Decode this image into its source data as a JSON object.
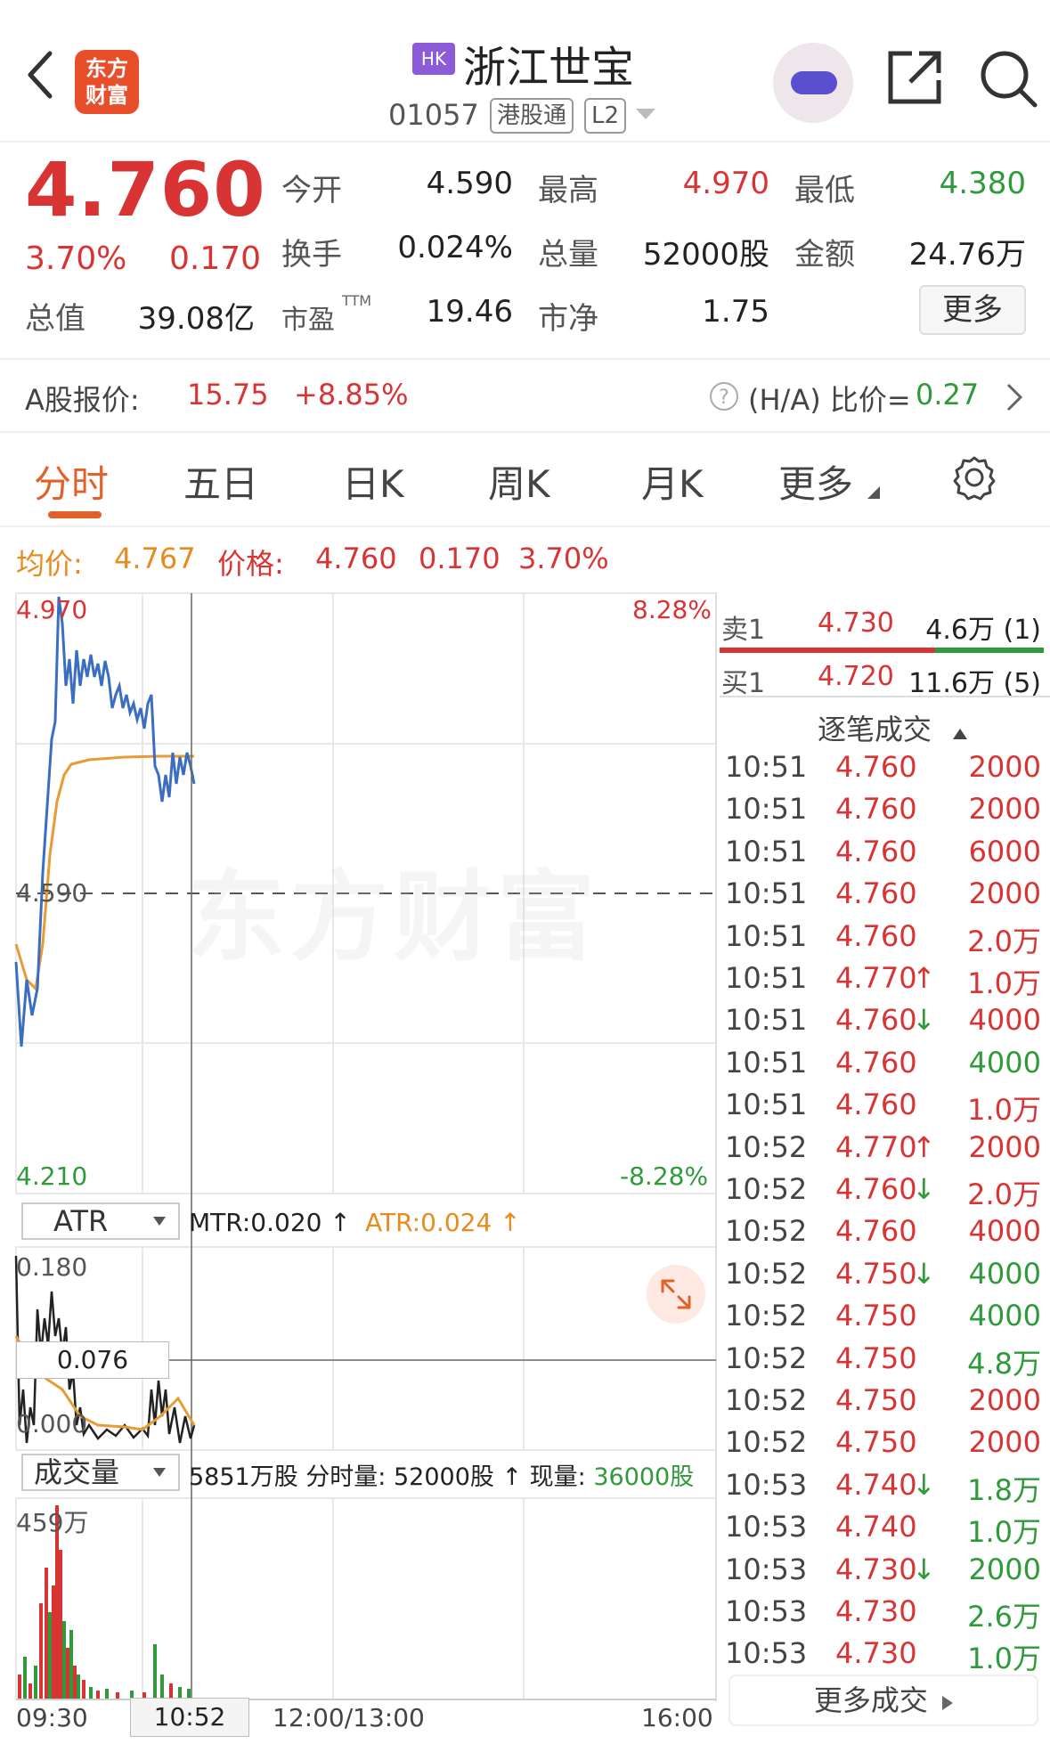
{
  "header": {
    "logo_text": "东方财富",
    "market_badge": "HK",
    "stock_name": "浙江世宝",
    "stock_code": "01057",
    "tags": [
      "港股通",
      "L2"
    ]
  },
  "quote": {
    "price": "4.760",
    "change_pct": "3.70%",
    "change": "0.170",
    "fields": [
      {
        "label": "今开",
        "value": "4.590",
        "color": "#222222"
      },
      {
        "label": "最高",
        "value": "4.970",
        "color": "#d93434"
      },
      {
        "label": "最低",
        "value": "4.380",
        "color": "#2f9a3a"
      },
      {
        "label": "换手",
        "value": "0.024%",
        "color": "#222222"
      },
      {
        "label": "总量",
        "value": "52000股",
        "color": "#222222"
      },
      {
        "label": "金额",
        "value": "24.76万",
        "color": "#222222"
      },
      {
        "label": "总值",
        "value": "39.08亿",
        "color": "#222222"
      },
      {
        "label": "市盈",
        "value": "19.46",
        "color": "#222222"
      },
      {
        "label": "市净",
        "value": "1.75",
        "color": "#222222"
      }
    ],
    "pe_superscript": "TTM",
    "more_button": "更多"
  },
  "a_share": {
    "label": "A股报价:",
    "price": "15.75",
    "change_pct": "+8.85%",
    "ha_label": "(H/A) 比价=",
    "ha_value": "0.27"
  },
  "tabs": [
    "分时",
    "五日",
    "日K",
    "周K",
    "月K",
    "更多"
  ],
  "intraday": {
    "avg_label": "均价:",
    "avg_value": "4.767",
    "price_label": "价格:",
    "price_value": "4.760",
    "change": "0.170",
    "change_pct": "3.70%",
    "y_max": "4.970",
    "y_open": "4.590",
    "y_min": "4.210",
    "pct_max": "8.28%",
    "pct_min": "-8.28%",
    "watermark": "东方财富"
  },
  "atr": {
    "dropdown": "ATR",
    "mtr_text": "MTR:0.020 ↑",
    "atr_text": "ATR:0.024 ↑",
    "y_max": "0.180",
    "y_cross": "0.076",
    "y_min": "0.000"
  },
  "volume": {
    "dropdown": "成交量",
    "summary_prefix": "5851万股",
    "summary_mid": " 分时量: 52000股 ↑ 现量: ",
    "current_volume": "36000股",
    "y_max": "459万",
    "time_labels": [
      "09:30",
      "10:52",
      "12:00/13:00",
      "16:00"
    ]
  },
  "orderbook": {
    "sell": {
      "label": "卖1",
      "price": "4.730",
      "volume": "4.6万 (1)"
    },
    "buy": {
      "label": "买1",
      "price": "4.720",
      "volume": "11.6万 (5)"
    }
  },
  "ticks_header": "逐笔成交",
  "ticks": [
    {
      "time": "10:51",
      "price": "4.760",
      "arrow": "",
      "vol": "2000",
      "vcolor": "#d93434"
    },
    {
      "time": "10:51",
      "price": "4.760",
      "arrow": "",
      "vol": "2000",
      "vcolor": "#d93434"
    },
    {
      "time": "10:51",
      "price": "4.760",
      "arrow": "",
      "vol": "6000",
      "vcolor": "#d93434"
    },
    {
      "time": "10:51",
      "price": "4.760",
      "arrow": "",
      "vol": "2000",
      "vcolor": "#d93434"
    },
    {
      "time": "10:51",
      "price": "4.760",
      "arrow": "",
      "vol": "2.0万",
      "vcolor": "#d93434"
    },
    {
      "time": "10:51",
      "price": "4.770",
      "arrow": "↑",
      "vol": "1.0万",
      "vcolor": "#d93434"
    },
    {
      "time": "10:51",
      "price": "4.760",
      "arrow": "↓",
      "vol": "4000",
      "vcolor": "#d93434"
    },
    {
      "time": "10:51",
      "price": "4.760",
      "arrow": "",
      "vol": "4000",
      "vcolor": "#2f9a3a"
    },
    {
      "time": "10:51",
      "price": "4.760",
      "arrow": "",
      "vol": "1.0万",
      "vcolor": "#d93434"
    },
    {
      "time": "10:52",
      "price": "4.770",
      "arrow": "↑",
      "vol": "2000",
      "vcolor": "#d93434"
    },
    {
      "time": "10:52",
      "price": "4.760",
      "arrow": "↓",
      "vol": "2.0万",
      "vcolor": "#d93434"
    },
    {
      "time": "10:52",
      "price": "4.760",
      "arrow": "",
      "vol": "4000",
      "vcolor": "#d93434"
    },
    {
      "time": "10:52",
      "price": "4.750",
      "arrow": "↓",
      "vol": "4000",
      "vcolor": "#2f9a3a"
    },
    {
      "time": "10:52",
      "price": "4.750",
      "arrow": "",
      "vol": "4000",
      "vcolor": "#2f9a3a"
    },
    {
      "time": "10:52",
      "price": "4.750",
      "arrow": "",
      "vol": "4.8万",
      "vcolor": "#2f9a3a"
    },
    {
      "time": "10:52",
      "price": "4.750",
      "arrow": "",
      "vol": "2000",
      "vcolor": "#d93434"
    },
    {
      "time": "10:52",
      "price": "4.750",
      "arrow": "",
      "vol": "2000",
      "vcolor": "#d93434"
    },
    {
      "time": "10:53",
      "price": "4.740",
      "arrow": "↓",
      "vol": "1.8万",
      "vcolor": "#2f9a3a"
    },
    {
      "time": "10:53",
      "price": "4.740",
      "arrow": "",
      "vol": "1.0万",
      "vcolor": "#2f9a3a"
    },
    {
      "time": "10:53",
      "price": "4.730",
      "arrow": "↓",
      "vol": "2000",
      "vcolor": "#2f9a3a"
    },
    {
      "time": "10:53",
      "price": "4.730",
      "arrow": "",
      "vol": "2.6万",
      "vcolor": "#2f9a3a"
    },
    {
      "time": "10:53",
      "price": "4.730",
      "arrow": "",
      "vol": "1.0万",
      "vcolor": "#2f9a3a"
    }
  ],
  "more_deals": "更多成交",
  "colors": {
    "up": "#d93434",
    "down": "#2f9a3a",
    "accent": "#e0622a",
    "price_line": "#3b6ec2",
    "avg_line": "#e89b35"
  }
}
